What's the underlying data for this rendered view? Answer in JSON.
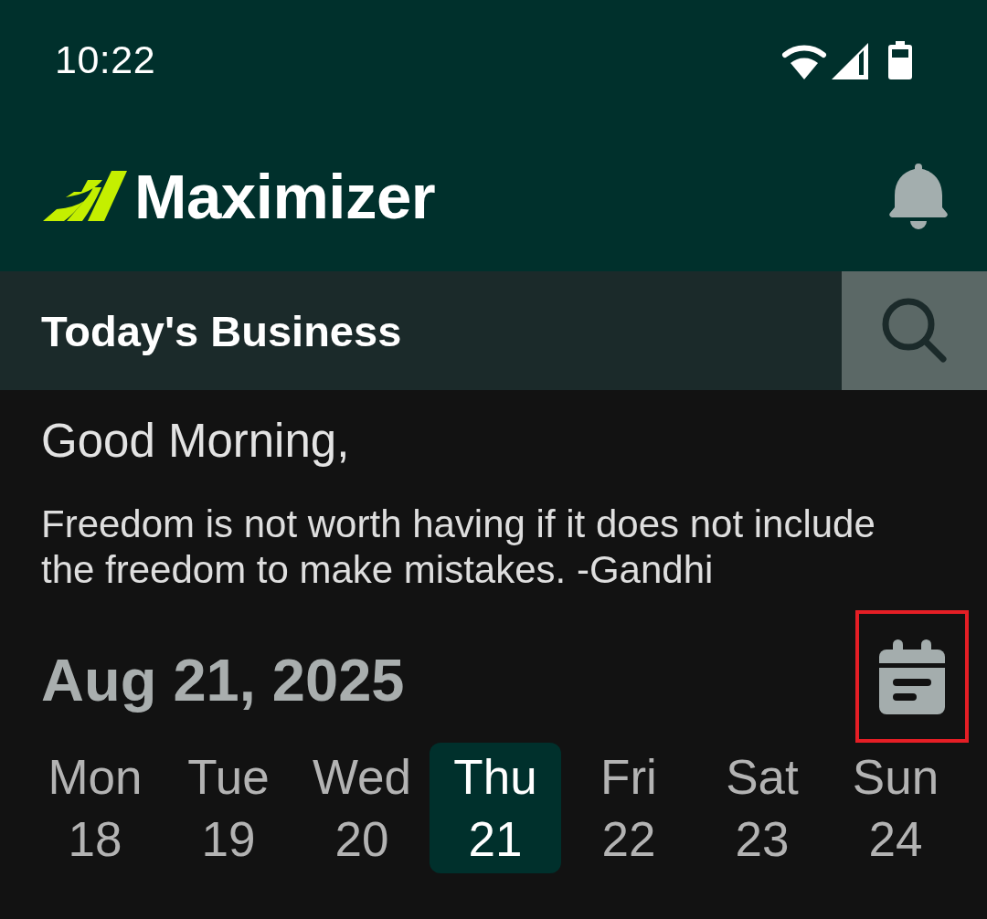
{
  "status_bar": {
    "time": "10:22"
  },
  "header": {
    "logo_text": "Maximizer"
  },
  "title_bar": {
    "title": "Today's Business"
  },
  "greeting": "Good Morning,",
  "quote": "Freedom is not worth having if it does not include the freedom to make mistakes. -Gandhi",
  "date": {
    "label": "Aug 21, 2025",
    "calendar_button": {
      "highlighted": true
    }
  },
  "week": [
    {
      "day": "Mon",
      "date": "18",
      "selected": false
    },
    {
      "day": "Tue",
      "date": "19",
      "selected": false
    },
    {
      "day": "Wed",
      "date": "20",
      "selected": false
    },
    {
      "day": "Thu",
      "date": "21",
      "selected": true
    },
    {
      "day": "Fri",
      "date": "22",
      "selected": false
    },
    {
      "day": "Sat",
      "date": "23",
      "selected": false
    },
    {
      "day": "Sun",
      "date": "24",
      "selected": false
    }
  ]
}
